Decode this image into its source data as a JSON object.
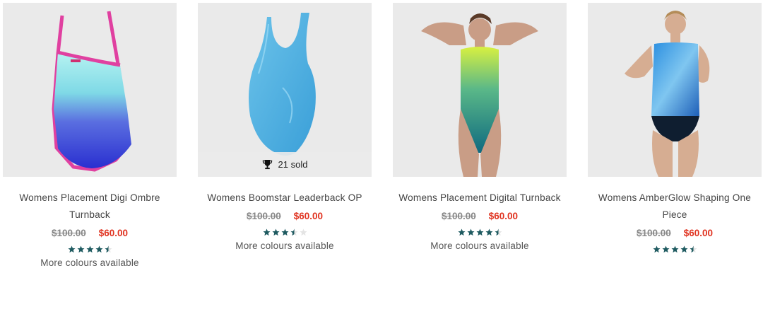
{
  "accent_star_color": "#1e5a60",
  "price_sale_color": "#e0321f",
  "products": [
    {
      "name": "Womens Placement Digi Ombre Turnback",
      "original_price": "$100.00",
      "sale_price": "$60.00",
      "rating": 4.5,
      "rating_max": 5,
      "more_colours": "More colours available"
    },
    {
      "name": "Womens Boomstar Leaderback OP",
      "original_price": "$100.00",
      "sale_price": "$60.00",
      "rating": 3.5,
      "rating_max": 5,
      "sold_badge": "21 sold",
      "sold_icon": "trophy-icon",
      "more_colours": "More colours available"
    },
    {
      "name": "Womens Placement Digital Turnback",
      "original_price": "$100.00",
      "sale_price": "$60.00",
      "rating": 4.5,
      "rating_max": 5,
      "more_colours": "More colours available"
    },
    {
      "name": "Womens AmberGlow Shaping One Piece",
      "original_price": "$100.00",
      "sale_price": "$60.00",
      "rating": 4.5,
      "rating_max": 5
    }
  ]
}
